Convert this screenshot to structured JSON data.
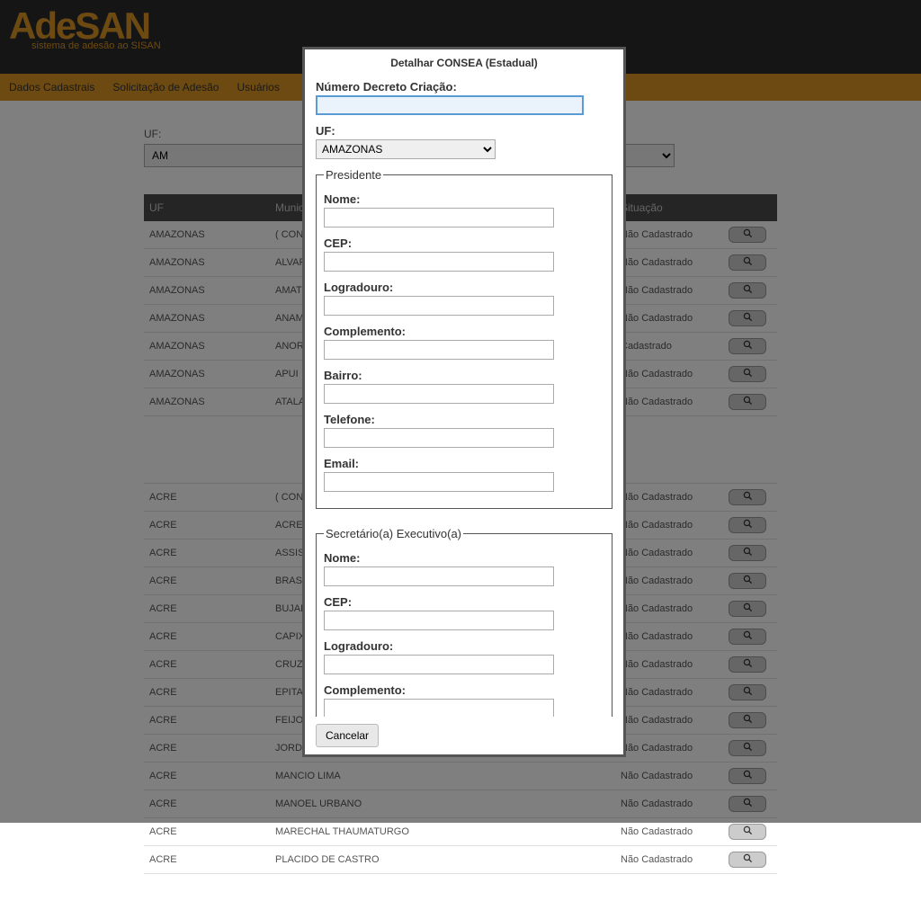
{
  "header": {
    "logo": "AdeSAN",
    "tagline": "sistema de adesão ao SISAN"
  },
  "nav": {
    "item1": "Dados Cadastrais",
    "item2": "Solicitação de Adesão",
    "item3": "Usuários"
  },
  "filter": {
    "label": "UF:",
    "value": "AM"
  },
  "tableHeaders": {
    "uf": "UF",
    "municipio": "Município",
    "situacao": "Situação"
  },
  "rows1": [
    {
      "uf": "AMAZONAS",
      "mun": "( CONSEA Estadual )",
      "sit": "Não Cadastrado",
      "cls": "nao"
    },
    {
      "uf": "AMAZONAS",
      "mun": "ALVARAES",
      "sit": "Não Cadastrado",
      "cls": "nao"
    },
    {
      "uf": "AMAZONAS",
      "mun": "AMATURA",
      "sit": "Não Cadastrado",
      "cls": "nao"
    },
    {
      "uf": "AMAZONAS",
      "mun": "ANAMA",
      "sit": "Não Cadastrado",
      "cls": "nao"
    },
    {
      "uf": "AMAZONAS",
      "mun": "ANORI",
      "sit": "Cadastrado",
      "cls": "sim"
    },
    {
      "uf": "AMAZONAS",
      "mun": "APUI",
      "sit": "Não Cadastrado",
      "cls": "nao"
    },
    {
      "uf": "AMAZONAS",
      "mun": "ATALAIA DO NORTE",
      "sit": "Não Cadastrado",
      "cls": "nao"
    }
  ],
  "rows2": [
    {
      "uf": "ACRE",
      "mun": "( CONSEA Estadual )",
      "sit": "Não Cadastrado",
      "cls": "nao"
    },
    {
      "uf": "ACRE",
      "mun": "ACRELANDIA",
      "sit": "Não Cadastrado",
      "cls": "nao"
    },
    {
      "uf": "ACRE",
      "mun": "ASSIS BRASIL",
      "sit": "Não Cadastrado",
      "cls": "nao"
    },
    {
      "uf": "ACRE",
      "mun": "BRASILEIA",
      "sit": "Não Cadastrado",
      "cls": "nao"
    },
    {
      "uf": "ACRE",
      "mun": "BUJARI",
      "sit": "Não Cadastrado",
      "cls": "nao"
    },
    {
      "uf": "ACRE",
      "mun": "CAPIXABA",
      "sit": "Não Cadastrado",
      "cls": "nao"
    },
    {
      "uf": "ACRE",
      "mun": "CRUZEIRO DO SUL",
      "sit": "Não Cadastrado",
      "cls": "nao"
    },
    {
      "uf": "ACRE",
      "mun": "EPITACIOLANDIA",
      "sit": "Não Cadastrado",
      "cls": "nao"
    },
    {
      "uf": "ACRE",
      "mun": "FEIJO",
      "sit": "Não Cadastrado",
      "cls": "nao"
    },
    {
      "uf": "ACRE",
      "mun": "JORDAO",
      "sit": "Não Cadastrado",
      "cls": "nao"
    },
    {
      "uf": "ACRE",
      "mun": "MANCIO LIMA",
      "sit": "Não Cadastrado",
      "cls": "nao"
    },
    {
      "uf": "ACRE",
      "mun": "MANOEL URBANO",
      "sit": "Não Cadastrado",
      "cls": "nao"
    },
    {
      "uf": "ACRE",
      "mun": "MARECHAL THAUMATURGO",
      "sit": "Não Cadastrado",
      "cls": "nao"
    },
    {
      "uf": "ACRE",
      "mun": "PLACIDO DE CASTRO",
      "sit": "Não Cadastrado",
      "cls": "nao"
    }
  ],
  "modal": {
    "title": "Detalhar CONSEA (Estadual)",
    "numeroLabel": "Número Decreto Criação:",
    "ufLabel": "UF:",
    "ufValue": "AMAZONAS",
    "presidenteLegend": "Presidente",
    "secretarioLegend": "Secretário(a) Executivo(a)",
    "fields": {
      "nome": "Nome:",
      "cep": "CEP:",
      "logradouro": "Logradouro:",
      "complemento": "Complemento:",
      "bairro": "Bairro:",
      "telefone": "Telefone:",
      "email": "Email:"
    },
    "cancel": "Cancelar"
  }
}
